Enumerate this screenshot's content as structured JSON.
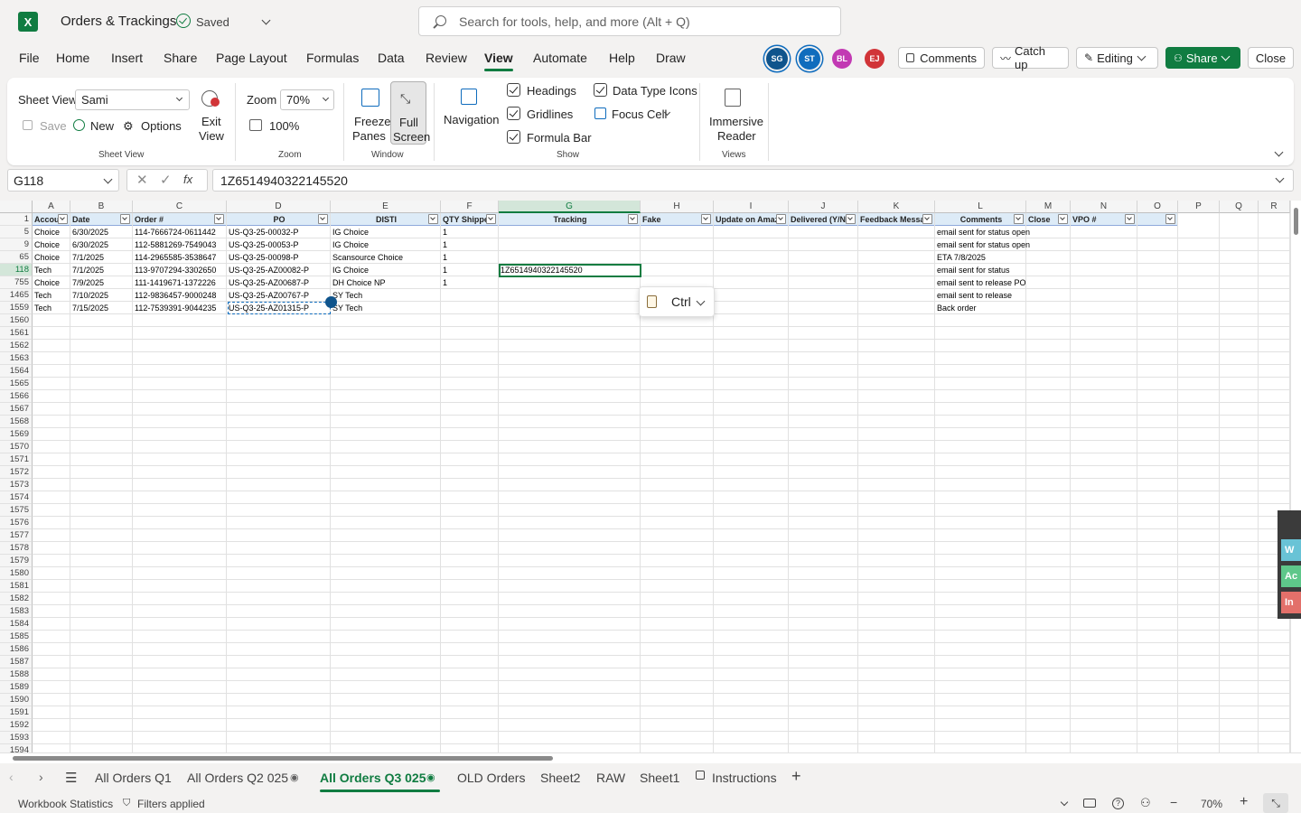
{
  "titlebar": {
    "app_letter": "X",
    "doc_title": "Orders & Trackings",
    "saved_label": "Saved",
    "search_placeholder": "Search for tools, help, and more (Alt + Q)"
  },
  "menu": {
    "tabs": [
      "File",
      "Home",
      "Insert",
      "Share",
      "Page Layout",
      "Formulas",
      "Data",
      "Review",
      "View",
      "Automate",
      "Help",
      "Draw"
    ],
    "active_tab": "View"
  },
  "collaborators": [
    {
      "initials": "SG",
      "color": "#0f548c"
    },
    {
      "initials": "ST",
      "color": "#0f6cbd"
    },
    {
      "initials": "BL",
      "color": "#c239b3"
    },
    {
      "initials": "EJ",
      "color": "#d13438"
    }
  ],
  "header_buttons": {
    "comments": "Comments",
    "catch_up": "Catch up",
    "editing": "Editing",
    "share": "Share",
    "close": "Close"
  },
  "ribbon": {
    "sheet_view_label": "Sheet View",
    "sheet_view_value": "Sami",
    "save": "Save",
    "new": "New",
    "options": "Options",
    "exit_view": [
      "Exit",
      "View"
    ],
    "group_sheet_view": "Sheet View",
    "zoom_label": "Zoom",
    "zoom_value": "70%",
    "zoom_100": "100%",
    "group_zoom": "Zoom",
    "freeze_panes": [
      "Freeze",
      "Panes"
    ],
    "full_screen": [
      "Full",
      "Screen"
    ],
    "group_window": "Window",
    "navigation": "Navigation",
    "headings": "Headings",
    "gridlines": "Gridlines",
    "formula_bar": "Formula Bar",
    "data_type_icons": "Data Type Icons",
    "focus_cell": "Focus Cell",
    "group_show": "Show",
    "immersive_reader": [
      "Immersive",
      "Reader"
    ],
    "group_views": "Views"
  },
  "formula_bar": {
    "cell_ref": "G118",
    "content": "1Z6514940322145520"
  },
  "grid": {
    "columns": [
      "A",
      "B",
      "C",
      "D",
      "E",
      "F",
      "G",
      "H",
      "I",
      "J",
      "K",
      "L",
      "M",
      "N",
      "O",
      "P",
      "Q",
      "R"
    ],
    "headers": [
      "Accou",
      "Date",
      "Order #",
      "PO",
      "DISTI",
      "QTY Shipped",
      "Tracking",
      "Fake",
      "Update on Amaz",
      "Delivered (Y/N",
      "Feedback Messa",
      "Comments",
      "Close",
      "VPO #",
      "",
      "",
      "",
      ""
    ],
    "header_row_num": "1",
    "rows": [
      {
        "num": "5",
        "cells": [
          "Choice",
          "6/30/2025",
          "114-7666724-0611442",
          "US-Q3-25-00032-P",
          "IG Choice",
          "1",
          "",
          "",
          "",
          "",
          "",
          "email sent for status open",
          "",
          ""
        ]
      },
      {
        "num": "9",
        "cells": [
          "Choice",
          "6/30/2025",
          "112-5881269-7549043",
          "US-Q3-25-00053-P",
          "IG Choice",
          "1",
          "",
          "",
          "",
          "",
          "",
          "email sent for status open",
          "",
          ""
        ]
      },
      {
        "num": "65",
        "cells": [
          "Choice",
          "7/1/2025",
          "114-2965585-3538647",
          "US-Q3-25-00098-P",
          "Scansource Choice",
          "1",
          "",
          "",
          "",
          "",
          "",
          "ETA 7/8/2025",
          "",
          ""
        ]
      },
      {
        "num": "118",
        "cells": [
          "Tech",
          "7/1/2025",
          "113-9707294-3302650",
          "US-Q3-25-AZ00082-P",
          "IG Choice",
          "1",
          "1Z6514940322145520",
          "",
          "",
          "",
          "",
          "email sent for status",
          "",
          ""
        ]
      },
      {
        "num": "755",
        "cells": [
          "Choice",
          "7/9/2025",
          "111-1419671-1372226",
          "US-Q3-25-AZ00687-P",
          "DH Choice NP",
          "1",
          "",
          "",
          "",
          "",
          "",
          "email sent to release PO",
          "",
          ""
        ]
      },
      {
        "num": "1465",
        "cells": [
          "Tech",
          "7/10/2025",
          "112-9836457-9000248",
          "US-Q3-25-AZ00767-P",
          "SY Tech",
          "",
          "",
          "",
          "",
          "",
          "",
          "email sent to release",
          "",
          ""
        ]
      },
      {
        "num": "1559",
        "cells": [
          "Tech",
          "7/15/2025",
          "112-7539391-9044235",
          "US-Q3-25-AZ01315-P",
          "SY Tech",
          "",
          "",
          "",
          "",
          "",
          "",
          "Back order",
          "",
          ""
        ]
      }
    ],
    "empty_rows": [
      "1560",
      "1561",
      "1562",
      "1563",
      "1564",
      "1565",
      "1566",
      "1567",
      "1568",
      "1569",
      "1570",
      "1571",
      "1572",
      "1573",
      "1574",
      "1575",
      "1576",
      "1577",
      "1578",
      "1579",
      "1580",
      "1581",
      "1582",
      "1583",
      "1584",
      "1585",
      "1586",
      "1587",
      "1588",
      "1589",
      "1590",
      "1591",
      "1592",
      "1593",
      "1594"
    ],
    "selected_row": "118",
    "selected_col": "G",
    "paste_options_label": "Ctrl"
  },
  "side_panel": {
    "labels": [
      "W",
      "Ac",
      "In"
    ],
    "colors": [
      "#69c3d6",
      "#5ec78a",
      "#e3706a"
    ]
  },
  "sheet_tabs": [
    "All Orders Q1",
    "All Orders Q2 025",
    "All Orders Q3 025",
    "OLD Orders",
    "Sheet2",
    "RAW",
    "Sheet1",
    "Instructions"
  ],
  "active_sheet": "All Orders Q3 025",
  "statusbar": {
    "workbook_stats": "Workbook Statistics",
    "filters": "Filters applied",
    "zoom": "70%"
  }
}
